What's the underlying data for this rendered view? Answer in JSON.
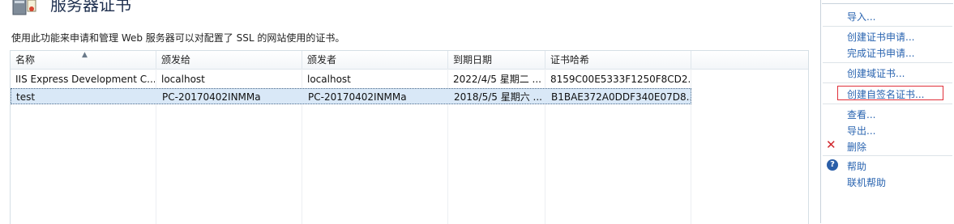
{
  "header": {
    "title": "服务器证书",
    "description": "使用此功能来申请和管理 Web 服务器可以对配置了 SSL 的网站使用的证书。"
  },
  "table": {
    "columns": [
      "名称",
      "颁发给",
      "颁发者",
      "到期日期",
      "证书哈希"
    ],
    "sorted_column": "名称",
    "rows": [
      [
        "IIS Express Development C...",
        "localhost",
        "localhost",
        "2022/4/5 星期二 ...",
        "8159C00E5333F1250F8CD2..."
      ],
      [
        "test",
        "PC-20170402INMMa",
        "PC-20170402INMMa",
        "2018/5/5 星期六 ...",
        "B1BAE372A0DDF340E07D8..."
      ]
    ],
    "selected_row": 1
  },
  "actions": {
    "import": "导入...",
    "create_request": "创建证书申请...",
    "complete_request": "完成证书申请...",
    "create_domain_cert": "创建域证书...",
    "create_self_signed": "创建自签名证书...",
    "view": "查看...",
    "export": "导出...",
    "remove": "删除",
    "help": "帮助",
    "online_help": "联机帮助"
  },
  "icons": {
    "server": "server-certificate-icon",
    "remove": "red-x-icon",
    "help": "help-circle-icon"
  },
  "colors": {
    "link": "#2a64b0",
    "selection": "#d9e8f7",
    "highlight_box": "#e0303a",
    "remove_icon": "#d0262c",
    "help_icon": "#2a5ea8"
  }
}
